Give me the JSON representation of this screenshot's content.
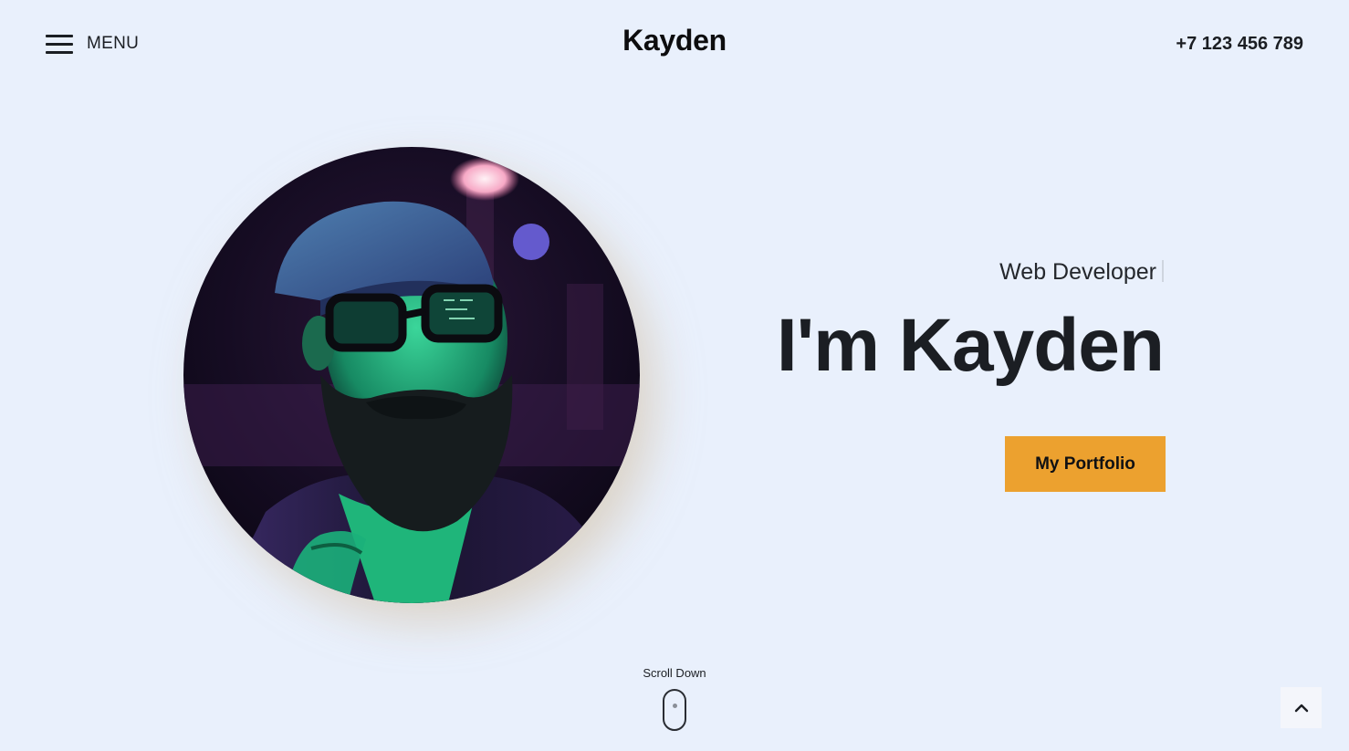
{
  "header": {
    "menu_label": "MENU",
    "logo": "Kayden",
    "phone": "+7 123 456 789"
  },
  "hero": {
    "subtitle": "Web Developer",
    "headline": "I'm Kayden",
    "cta_label": "My Portfolio",
    "portrait_alt": "Bearded man with cap and glasses in neon light"
  },
  "scroll": {
    "label": "Scroll Down"
  },
  "icons": {
    "menu": "hamburger-icon",
    "scroll": "mouse-icon",
    "back_to_top": "chevron-up-icon"
  },
  "colors": {
    "background": "#e9f0fc",
    "accent": "#eca12f",
    "text": "#1b1e23"
  }
}
